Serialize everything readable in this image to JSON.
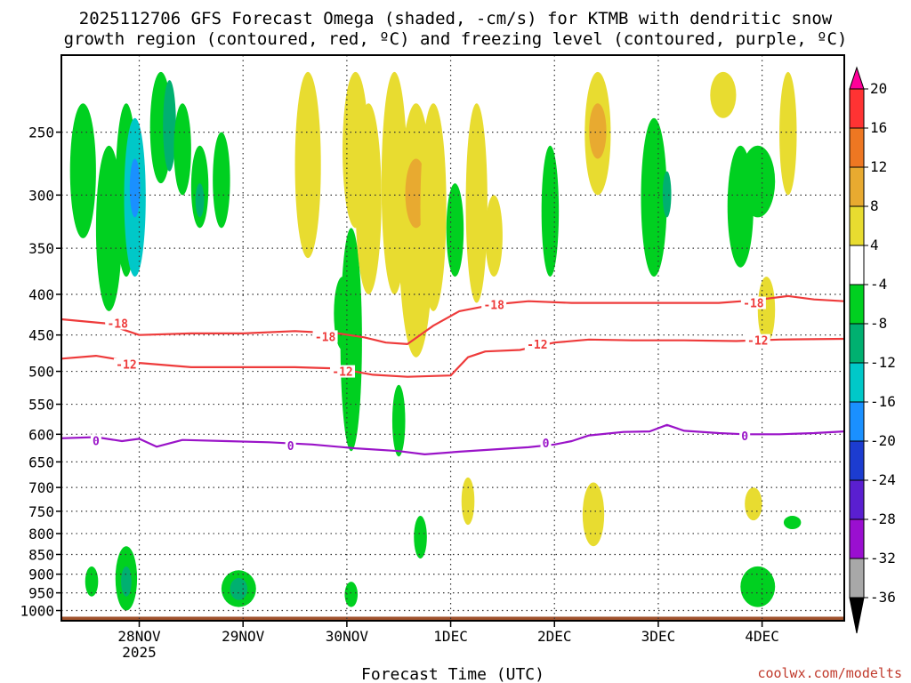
{
  "chart_data": {
    "type": "heatmap",
    "title_lines": [
      "2025112706 GFS Forecast Omega (shaded, -cm/s) for KTMB with dendritic snow",
      "growth region (contoured, red, ºC) and freezing level (contoured, purple, ºC)"
    ],
    "xlabel": "Forecast Time (UTC)",
    "credit": "coolwx.com/modelts",
    "x_ticks": [
      {
        "label": "28NOV",
        "sub": "2025",
        "hours": 0
      },
      {
        "label": "29NOV",
        "sub": "",
        "hours": 24
      },
      {
        "label": "30NOV",
        "sub": "",
        "hours": 48
      },
      {
        "label": "1DEC",
        "sub": "",
        "hours": 72
      },
      {
        "label": "2DEC",
        "sub": "",
        "hours": 96
      },
      {
        "label": "3DEC",
        "sub": "",
        "hours": 120
      },
      {
        "label": "4DEC",
        "sub": "",
        "hours": 144
      }
    ],
    "x_range_hours": [
      -18,
      163
    ],
    "y_ticks": [
      250,
      300,
      350,
      400,
      450,
      500,
      550,
      600,
      650,
      700,
      750,
      800,
      850,
      900,
      950,
      1000
    ],
    "y_range_hpa": [
      200,
      1030
    ],
    "y_scale": "log-pressure",
    "grid": true,
    "colorbar": {
      "labels": [
        "20",
        "16",
        "12",
        "8",
        "4",
        "-4",
        "-8",
        "-12",
        "-16",
        "-20",
        "-24",
        "-28",
        "-32",
        "-36"
      ],
      "colors": [
        "#ff0099",
        "#ff3333",
        "#ee7722",
        "#e8aa30",
        "#e8dc30",
        "#ffffff",
        "#00d020",
        "#00b070",
        "#00c8c8",
        "#1a90ff",
        "#1c3cd0",
        "#5a1fd0",
        "#9a0fd0",
        "#a8a8a8",
        "#000000"
      ]
    },
    "omega_blobs": [
      {
        "h": -13,
        "p1": 230,
        "p2": 340,
        "w": 3,
        "v": -6
      },
      {
        "h": -7,
        "p1": 260,
        "p2": 420,
        "w": 3,
        "v": -6
      },
      {
        "h": -3,
        "p1": 230,
        "p2": 380,
        "w": 2.5,
        "v": -6
      },
      {
        "h": -1,
        "p1": 240,
        "p2": 380,
        "w": 2.5,
        "v": -16
      },
      {
        "h": -1,
        "p1": 270,
        "p2": 320,
        "w": 1.2,
        "v": -20
      },
      {
        "h": 5,
        "p1": 210,
        "p2": 290,
        "w": 2.5,
        "v": -6
      },
      {
        "h": 7,
        "p1": 215,
        "p2": 280,
        "w": 1.5,
        "v": -12
      },
      {
        "h": 10,
        "p1": 230,
        "p2": 300,
        "w": 2,
        "v": -6
      },
      {
        "h": 14,
        "p1": 260,
        "p2": 330,
        "w": 2,
        "v": -6
      },
      {
        "h": 14,
        "p1": 290,
        "p2": 320,
        "w": 1,
        "v": -12
      },
      {
        "h": 19,
        "p1": 250,
        "p2": 330,
        "w": 2,
        "v": -6
      },
      {
        "h": 39,
        "p1": 210,
        "p2": 360,
        "w": 3,
        "v": 4
      },
      {
        "h": 47,
        "p1": 380,
        "p2": 470,
        "w": 2,
        "v": -6
      },
      {
        "h": 49,
        "p1": 330,
        "p2": 630,
        "w": 2.5,
        "v": -6
      },
      {
        "h": 50,
        "p1": 210,
        "p2": 330,
        "w": 3,
        "v": 4
      },
      {
        "h": 53,
        "p1": 230,
        "p2": 400,
        "w": 3,
        "v": 4
      },
      {
        "h": 59,
        "p1": 210,
        "p2": 400,
        "w": 3,
        "v": 4
      },
      {
        "h": 60,
        "p1": 520,
        "p2": 640,
        "w": 1.5,
        "v": -6
      },
      {
        "h": 64,
        "p1": 230,
        "p2": 480,
        "w": 4,
        "v": 4
      },
      {
        "h": 64,
        "p1": 270,
        "p2": 330,
        "w": 2.5,
        "v": 8
      },
      {
        "h": 68,
        "p1": 230,
        "p2": 420,
        "w": 3,
        "v": 4
      },
      {
        "h": 73,
        "p1": 290,
        "p2": 380,
        "w": 2,
        "v": -6
      },
      {
        "h": 78,
        "p1": 230,
        "p2": 410,
        "w": 2.5,
        "v": 4
      },
      {
        "h": 82,
        "p1": 300,
        "p2": 380,
        "w": 2,
        "v": 4
      },
      {
        "h": 95,
        "p1": 260,
        "p2": 380,
        "w": 2,
        "v": -6
      },
      {
        "h": 106,
        "p1": 210,
        "p2": 300,
        "w": 3,
        "v": 4
      },
      {
        "h": 106,
        "p1": 230,
        "p2": 270,
        "w": 2,
        "v": 8
      },
      {
        "h": 119,
        "p1": 240,
        "p2": 380,
        "w": 3,
        "v": -6
      },
      {
        "h": 122,
        "p1": 280,
        "p2": 320,
        "w": 1,
        "v": -12
      },
      {
        "h": 135,
        "p1": 210,
        "p2": 240,
        "w": 3,
        "v": 4
      },
      {
        "h": 139,
        "p1": 260,
        "p2": 370,
        "w": 3,
        "v": -6
      },
      {
        "h": 143,
        "p1": 260,
        "p2": 320,
        "w": 4,
        "v": -6
      },
      {
        "h": 145,
        "p1": 380,
        "p2": 460,
        "w": 2,
        "v": 4
      },
      {
        "h": 150,
        "p1": 210,
        "p2": 300,
        "w": 2,
        "v": 4
      },
      {
        "h": -11,
        "p1": 880,
        "p2": 960,
        "w": 1.5,
        "v": -6
      },
      {
        "h": -3,
        "p1": 830,
        "p2": 1000,
        "w": 2.5,
        "v": -6
      },
      {
        "h": -3,
        "p1": 880,
        "p2": 960,
        "w": 1.2,
        "v": -12
      },
      {
        "h": 23,
        "p1": 890,
        "p2": 990,
        "w": 4,
        "v": -6
      },
      {
        "h": 23,
        "p1": 910,
        "p2": 970,
        "w": 2,
        "v": -12
      },
      {
        "h": 49,
        "p1": 920,
        "p2": 990,
        "w": 1.5,
        "v": -6
      },
      {
        "h": 65,
        "p1": 760,
        "p2": 860,
        "w": 1.5,
        "v": -6
      },
      {
        "h": 76,
        "p1": 680,
        "p2": 780,
        "w": 1.5,
        "v": 4
      },
      {
        "h": 105,
        "p1": 690,
        "p2": 830,
        "w": 2.5,
        "v": 4
      },
      {
        "h": 143,
        "p1": 880,
        "p2": 990,
        "w": 4,
        "v": -6
      },
      {
        "h": 142,
        "p1": 700,
        "p2": 770,
        "w": 2,
        "v": 4
      },
      {
        "h": 151,
        "p1": 760,
        "p2": 790,
        "w": 2,
        "v": -6
      }
    ],
    "contours": [
      {
        "name": "-18",
        "color": "#ee3b3b",
        "points": [
          [
            -18,
            430
          ],
          [
            -8,
            435
          ],
          [
            0,
            450
          ],
          [
            12,
            448
          ],
          [
            24,
            448
          ],
          [
            36,
            445
          ],
          [
            46,
            448
          ],
          [
            52,
            453
          ],
          [
            57,
            460
          ],
          [
            62,
            462
          ],
          [
            68,
            438
          ],
          [
            74,
            420
          ],
          [
            82,
            412
          ],
          [
            90,
            408
          ],
          [
            100,
            410
          ],
          [
            112,
            410
          ],
          [
            124,
            410
          ],
          [
            134,
            410
          ],
          [
            142,
            407
          ],
          [
            150,
            402
          ],
          [
            156,
            406
          ],
          [
            163,
            408
          ]
        ],
        "labels": [
          [
            -5,
            435
          ],
          [
            43,
            452
          ],
          [
            82,
            412
          ],
          [
            142,
            410
          ]
        ]
      },
      {
        "name": "-12",
        "color": "#ee3b3b",
        "points": [
          [
            -18,
            482
          ],
          [
            -10,
            478
          ],
          [
            0,
            488
          ],
          [
            12,
            494
          ],
          [
            24,
            494
          ],
          [
            36,
            494
          ],
          [
            46,
            496
          ],
          [
            54,
            505
          ],
          [
            62,
            508
          ],
          [
            72,
            506
          ],
          [
            76,
            480
          ],
          [
            80,
            472
          ],
          [
            88,
            470
          ],
          [
            96,
            460
          ],
          [
            104,
            456
          ],
          [
            114,
            457
          ],
          [
            126,
            457
          ],
          [
            138,
            458
          ],
          [
            148,
            456
          ],
          [
            163,
            455
          ]
        ],
        "labels": [
          [
            -3,
            490
          ],
          [
            47,
            500
          ],
          [
            92,
            462
          ],
          [
            143,
            457
          ]
        ]
      },
      {
        "name": "0",
        "color": "#9a14c8",
        "points": [
          [
            -18,
            607
          ],
          [
            -10,
            605
          ],
          [
            -4,
            612
          ],
          [
            0,
            608
          ],
          [
            4,
            622
          ],
          [
            10,
            610
          ],
          [
            20,
            612
          ],
          [
            30,
            614
          ],
          [
            40,
            618
          ],
          [
            50,
            625
          ],
          [
            60,
            630
          ],
          [
            66,
            636
          ],
          [
            74,
            631
          ],
          [
            82,
            627
          ],
          [
            90,
            623
          ],
          [
            96,
            618
          ],
          [
            100,
            612
          ],
          [
            104,
            602
          ],
          [
            112,
            596
          ],
          [
            118,
            595
          ],
          [
            122,
            584
          ],
          [
            126,
            594
          ],
          [
            134,
            598
          ],
          [
            140,
            600
          ],
          [
            148,
            600
          ],
          [
            156,
            598
          ],
          [
            163,
            595
          ]
        ],
        "labels": [
          [
            -10,
            611
          ],
          [
            35,
            620
          ],
          [
            94,
            615
          ],
          [
            140,
            603
          ]
        ]
      }
    ],
    "terrain": {
      "top_hpa": 1018,
      "color": "#a0522d"
    }
  }
}
